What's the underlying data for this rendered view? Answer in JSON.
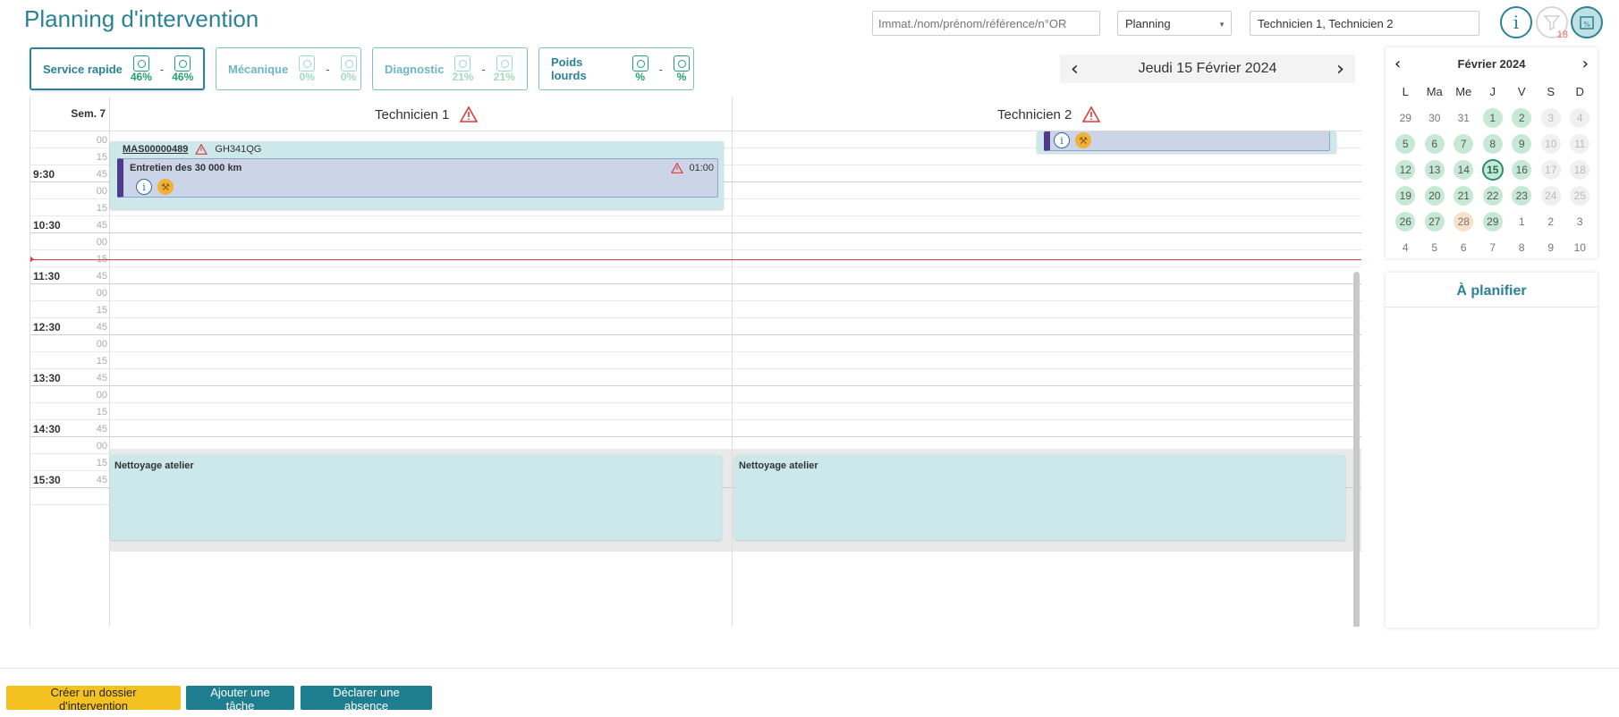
{
  "header": {
    "title": "Planning d'intervention",
    "search_placeholder": "Immat./nom/prénom/référence/n°OR",
    "view_select": "Planning",
    "tech_select": "Technicien 1, Technicien 2",
    "filter_badge": "18"
  },
  "categories": [
    {
      "label": "Service rapide",
      "v1": "46%",
      "v2": "46%"
    },
    {
      "label": "Mécanique",
      "v1": "0%",
      "v2": "0%"
    },
    {
      "label": "Diagnostic",
      "v1": "21%",
      "v2": "21%"
    },
    {
      "label": "Poids lourds",
      "v1": "%",
      "v2": "%"
    }
  ],
  "date_nav": {
    "date": "Jeudi 15 Février 2024",
    "prev": "‹",
    "next": "›"
  },
  "grid": {
    "week": "Sem. 7",
    "columns": [
      "Technicien 1",
      "Technicien 2"
    ],
    "rows": [
      {
        "min": "00"
      },
      {
        "min": "15"
      },
      {
        "hour": "9:30",
        "min": "45"
      },
      {
        "min": "00"
      },
      {
        "min": "15"
      },
      {
        "hour": "10:30",
        "min": "45"
      },
      {
        "min": "00"
      },
      {
        "min": "15"
      },
      {
        "hour": "11:30",
        "min": "45"
      },
      {
        "min": "00"
      },
      {
        "min": "15"
      },
      {
        "hour": "12:30",
        "min": "45"
      },
      {
        "min": "00"
      },
      {
        "min": "15"
      },
      {
        "hour": "13:30",
        "min": "45"
      },
      {
        "min": "00"
      },
      {
        "min": "15"
      },
      {
        "hour": "14:30",
        "min": "45"
      },
      {
        "min": "00"
      },
      {
        "min": "15"
      },
      {
        "hour": "15:30",
        "min": "45"
      },
      {
        "min": ""
      }
    ]
  },
  "events": {
    "ref": "MAS00000489",
    "plate": "GH341QG",
    "task_title": "Entretien des 30 000 km",
    "task_duration": "01:00",
    "cleaning_1": "Nettoyage atelier",
    "cleaning_2": "Nettoyage atelier"
  },
  "mini_calendar": {
    "month": "Février 2024",
    "prev": "‹",
    "next": "›",
    "dow": [
      "L",
      "Ma",
      "Me",
      "J",
      "V",
      "S",
      "D"
    ],
    "days": [
      {
        "d": "29",
        "s": "out"
      },
      {
        "d": "30",
        "s": "out"
      },
      {
        "d": "31",
        "s": "out"
      },
      {
        "d": "1",
        "s": "g"
      },
      {
        "d": "2",
        "s": "g"
      },
      {
        "d": "3",
        "s": "l"
      },
      {
        "d": "4",
        "s": "l"
      },
      {
        "d": "5",
        "s": "g"
      },
      {
        "d": "6",
        "s": "g"
      },
      {
        "d": "7",
        "s": "g"
      },
      {
        "d": "8",
        "s": "g"
      },
      {
        "d": "9",
        "s": "g"
      },
      {
        "d": "10",
        "s": "l"
      },
      {
        "d": "11",
        "s": "l"
      },
      {
        "d": "12",
        "s": "g"
      },
      {
        "d": "13",
        "s": "g"
      },
      {
        "d": "14",
        "s": "g"
      },
      {
        "d": "15",
        "s": "t"
      },
      {
        "d": "16",
        "s": "g"
      },
      {
        "d": "17",
        "s": "l"
      },
      {
        "d": "18",
        "s": "l"
      },
      {
        "d": "19",
        "s": "g"
      },
      {
        "d": "20",
        "s": "g"
      },
      {
        "d": "21",
        "s": "g"
      },
      {
        "d": "22",
        "s": "g"
      },
      {
        "d": "23",
        "s": "g"
      },
      {
        "d": "24",
        "s": "l"
      },
      {
        "d": "25",
        "s": "l"
      },
      {
        "d": "26",
        "s": "g"
      },
      {
        "d": "27",
        "s": "g"
      },
      {
        "d": "28",
        "s": "o"
      },
      {
        "d": "29",
        "s": "g"
      },
      {
        "d": "1",
        "s": "out"
      },
      {
        "d": "2",
        "s": "out"
      },
      {
        "d": "3",
        "s": "out"
      },
      {
        "d": "4",
        "s": "out"
      },
      {
        "d": "5",
        "s": "out"
      },
      {
        "d": "6",
        "s": "out"
      },
      {
        "d": "7",
        "s": "out"
      },
      {
        "d": "8",
        "s": "out"
      },
      {
        "d": "9",
        "s": "out"
      },
      {
        "d": "10",
        "s": "out"
      }
    ]
  },
  "to_plan": {
    "title": "À planifier"
  },
  "footer": {
    "create": "Créer un dossier d'intervention",
    "add_task": "Ajouter une tâche",
    "absence": "Déclarer une absence"
  },
  "colors": {
    "accent": "#2a8296",
    "now_line": "#e03a3a",
    "primary_button": "#f4c220",
    "secondary_button": "#1e7d8f"
  }
}
